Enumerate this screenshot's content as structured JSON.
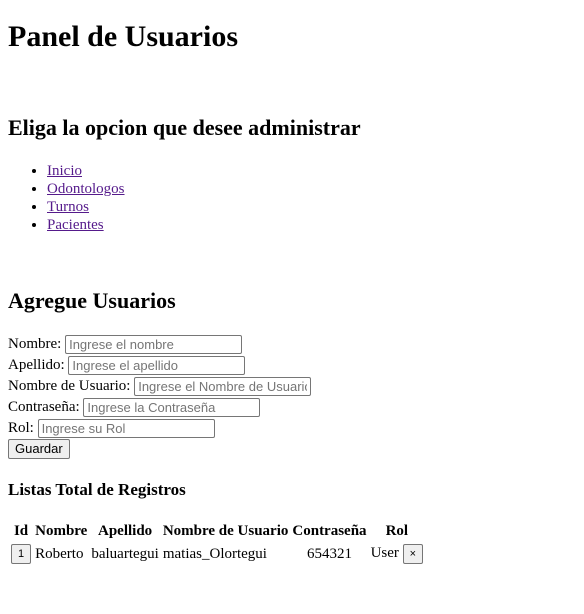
{
  "header": {
    "title": "Panel de Usuarios"
  },
  "nav": {
    "heading": "Eliga la opcion que desee administrar",
    "items": [
      {
        "label": "Inicio"
      },
      {
        "label": "Odontologos"
      },
      {
        "label": "Turnos"
      },
      {
        "label": "Pacientes"
      }
    ]
  },
  "form": {
    "heading": "Agregue Usuarios",
    "fields": {
      "nombre": {
        "label": "Nombre:",
        "placeholder": "Ingrese el nombre",
        "value": ""
      },
      "apellido": {
        "label": "Apellido:",
        "placeholder": "Ingrese el apellido",
        "value": ""
      },
      "usuario": {
        "label": "Nombre de Usuario:",
        "placeholder": "Ingrese el Nombre de Usuario",
        "value": ""
      },
      "contrasena": {
        "label": "Contraseña:",
        "placeholder": "Ingrese la Contraseña",
        "value": ""
      },
      "rol": {
        "label": "Rol:",
        "placeholder": "Ingrese su Rol",
        "value": ""
      }
    },
    "save_label": "Guardar"
  },
  "records": {
    "heading": "Listas Total de Registros",
    "columns": [
      "Id",
      "Nombre",
      "Apellido",
      "Nombre de Usuario",
      "Contraseña",
      "Rol"
    ],
    "rows": [
      {
        "id": "1",
        "nombre": "Roberto",
        "apellido": "baluartegui",
        "usuario": "matias_Olortegui",
        "contrasena": "654321",
        "rol": "User",
        "delete_label": "×"
      }
    ]
  }
}
